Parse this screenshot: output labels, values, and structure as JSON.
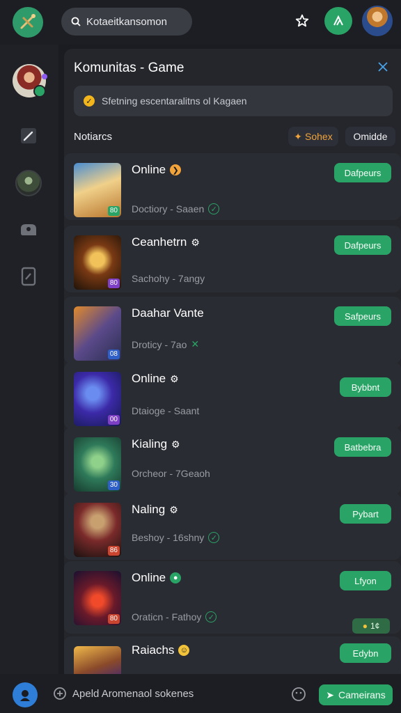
{
  "header": {
    "search_value": "Kotaeitkansomon"
  },
  "panel": {
    "title": "Komunitas - Game",
    "notice": "Sfetning escentaralitns ol Kagaen",
    "section_label": "Notiarcs",
    "chip_sort": "Sohex",
    "chip_other": "Omidde"
  },
  "rows": [
    {
      "title": "Online",
      "sub": "Doctiory - Saaen",
      "button": "Dafpeurs",
      "tag": "80",
      "tag_color": "#2aa466",
      "title_icon": "orange-chevron-icon",
      "sub_icon": "check-circle-icon"
    },
    {
      "title": "Ceanhetrn",
      "sub": "Sachohy - 7angy",
      "button": "Dafpeurs",
      "tag": "80",
      "tag_color": "#7d3fc4",
      "title_icon": "gear-icon",
      "sub_icon": ""
    },
    {
      "title": "Daahar Vante",
      "sub": "Droticy - 7ao",
      "button": "Safpeurs",
      "tag": "08",
      "tag_color": "#2e5fc7",
      "title_icon": "gear-icon",
      "sub_icon": "green-x-icon"
    },
    {
      "title": "Online",
      "sub": "Dtaioge - Saant",
      "button": "Bybbnt",
      "tag": "00",
      "tag_color": "#7d3fc4",
      "title_icon": "gear-icon",
      "sub_icon": ""
    },
    {
      "title": "Kialing",
      "sub": "Orcheor - 7Geaoh",
      "button": "Batbebra",
      "tag": "30",
      "tag_color": "#2e5fc7",
      "title_icon": "gear-icon",
      "sub_icon": ""
    },
    {
      "title": "Naling",
      "sub": "Beshoy - 16shny",
      "button": "Pybart",
      "tag": "86",
      "tag_color": "#c9452f",
      "title_icon": "gear-icon",
      "sub_icon": "check-circle-icon"
    },
    {
      "title": "Online",
      "sub": "Oraticn - Fathoy",
      "button": "Lfyon",
      "tag": "80",
      "tag_color": "#c9452f",
      "title_icon": "green-chat-icon",
      "sub_icon": "check-circle-icon",
      "count": "1¢"
    },
    {
      "title": "Raiachs",
      "sub": "",
      "button": "Edybn",
      "tag": "",
      "tag_color": "#7d3fc4",
      "title_icon": "yellow-emoji-icon",
      "sub_icon": ""
    }
  ],
  "bottom": {
    "placeholder": "Apeld Aromenaol sokenes",
    "send_label": "Cameirans"
  },
  "colors": {
    "accent_green": "#2aa466",
    "panel_bg": "#24262c",
    "row_bg": "#2a2c33",
    "sort_orange": "#f2a33a"
  }
}
